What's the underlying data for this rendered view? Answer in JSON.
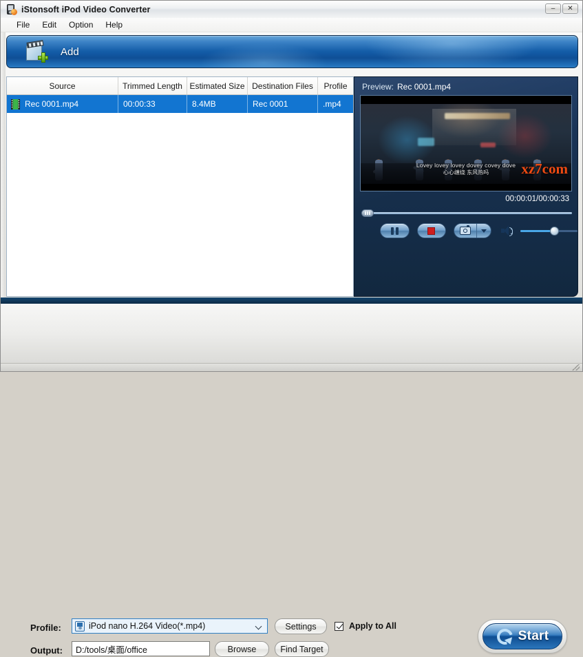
{
  "window": {
    "title": "iStonsoft iPod Video Converter",
    "app_icon": "ipod-app-icon",
    "buttons": [
      {
        "name": "minimize",
        "glyph": "–"
      },
      {
        "name": "close",
        "glyph": "✕"
      }
    ]
  },
  "menu": {
    "items": [
      {
        "label": "File"
      },
      {
        "label": "Edit"
      },
      {
        "label": "Option"
      },
      {
        "label": "Help"
      }
    ]
  },
  "toolbar": {
    "add_label": "Add",
    "add_icon": "add-video-icon"
  },
  "file_list": {
    "columns": [
      {
        "label": "Source"
      },
      {
        "label": "Trimmed Length"
      },
      {
        "label": "Estimated Size"
      },
      {
        "label": "Destination Files"
      },
      {
        "label": "Profile"
      }
    ],
    "rows": [
      {
        "icon": "film-strip-icon",
        "source": "Rec 0001.mp4",
        "trimmed_length": "00:00:33",
        "estimated_size": "8.4MB",
        "destination_file": "Rec 0001",
        "profile": ".mp4",
        "selected": true
      }
    ],
    "selection_color": "#1275d1"
  },
  "preview": {
    "label": "Preview:",
    "file_name": "Rec 0001.mp4",
    "timecode": "00:00:01/00:00:33",
    "video": {
      "subtitle_line1": "Lovey lovey lovey dovey covey dove",
      "subtitle_line2": "心心缠绕 东风热吗",
      "watermark": "xz7com"
    },
    "controls": [
      {
        "name": "pause-button",
        "icon": "pause-icon"
      },
      {
        "name": "stop-button",
        "icon": "stop-icon"
      },
      {
        "name": "snapshot-button",
        "icon": "camera-icon"
      },
      {
        "name": "snapshot-dropdown",
        "icon": "chevron-down-icon"
      },
      {
        "name": "volume-icon",
        "icon": "speaker-icon"
      }
    ],
    "seek_position_percent": 3,
    "volume_percent": 55
  },
  "settings": {
    "profile_label": "Profile:",
    "profile_value": "iPod nano H.264 Video(*.mp4)",
    "profile_icon": "ipod-device-icon",
    "output_label": "Output:",
    "output_value": "D:/tools/桌面/office",
    "settings_button": "Settings",
    "browse_button": "Browse",
    "find_target_button": "Find Target",
    "apply_to_all_label": "Apply to All",
    "apply_to_all_checked": true,
    "start_button": "Start",
    "accent_color": "#1275d1",
    "toolbar_blue": "#135ba6"
  }
}
